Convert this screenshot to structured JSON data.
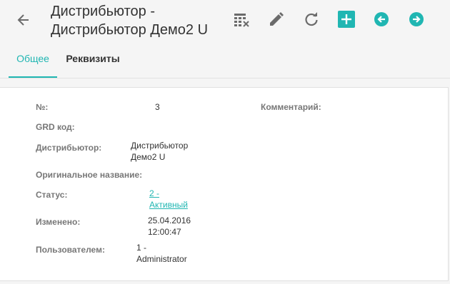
{
  "header": {
    "title_line1": "Дистрибьютор -",
    "title_line2": "Дистрибьютор Демо2 U",
    "icons": [
      "back-arrow-icon",
      "table-columns-icon",
      "pencil-icon",
      "refresh-icon",
      "plus-icon",
      "arrow-left-circle-icon",
      "arrow-right-circle-icon"
    ],
    "accent_color": "#20b6b2"
  },
  "tabs": [
    {
      "label": "Общее",
      "active": true
    },
    {
      "label": "Реквизиты",
      "active": false
    }
  ],
  "fields": {
    "number_label": "№:",
    "number_value": "3",
    "grd_label": "GRD код:",
    "distributor_label": "Дистрибьютор:",
    "distributor_value_line1": "Дистрибьютор",
    "distributor_value_line2": "Демо2 U",
    "original_name_label": "Оригинальное название:",
    "status_label": "Статус:",
    "status_value_line1": "2 -",
    "status_value_line2": "Активный",
    "changed_label": "Изменено:",
    "changed_date": "25.04.2016",
    "changed_time": "12:00:47",
    "user_label": "Пользователем:",
    "user_value_line1": "1 -",
    "user_value_line2": "Administrator",
    "comment_label": "Комментарий:"
  }
}
